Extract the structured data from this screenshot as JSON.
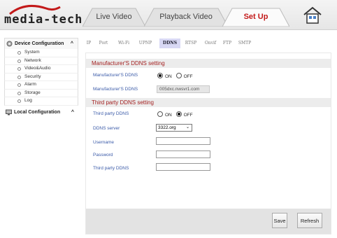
{
  "brand": {
    "name": "media-tech"
  },
  "main_tabs": [
    {
      "label": "Live Video"
    },
    {
      "label": "Playback Video"
    },
    {
      "label": "Set Up",
      "active": true
    }
  ],
  "sidebar": {
    "device_config": {
      "label": "Device Configuration",
      "caret": "^"
    },
    "items": [
      {
        "label": "System"
      },
      {
        "label": "Network"
      },
      {
        "label": "Video&Audio"
      },
      {
        "label": "Security"
      },
      {
        "label": "Alarm"
      },
      {
        "label": "Storage"
      },
      {
        "label": "Log"
      }
    ],
    "local_config": {
      "label": "Local Configuration",
      "caret": "^"
    }
  },
  "subtabs": [
    {
      "label": "IP"
    },
    {
      "label": "Port"
    },
    {
      "label": "Wi-Fi"
    },
    {
      "label": "UPNP"
    },
    {
      "label": "DDNS",
      "active": true
    },
    {
      "label": "RTSP"
    },
    {
      "label": "Onvif"
    },
    {
      "label": "FTP"
    },
    {
      "label": "SMTP"
    }
  ],
  "manufacturer": {
    "title": "Manufacturer'S DDNS setting",
    "ddns_label": "Manufacturer'S DDNS",
    "on_label": "ON",
    "off_label": "OFF",
    "selected": "ON",
    "address_label": "Manufacturer'S DDNS",
    "address_value": "005dxc.nwsvr1.com"
  },
  "third_party": {
    "title": "Third party DDNS setting",
    "ddns_label": "Third party DDNS",
    "on_label": "ON",
    "off_label": "OFF",
    "selected": "OFF",
    "server_label": "DDNS server",
    "server_value": "3322.org",
    "username_label": "Username",
    "username_value": "",
    "password_label": "Password",
    "password_value": "",
    "third_label": "Third party DDNS",
    "third_value": ""
  },
  "buttons": {
    "save": "Save",
    "refresh": "Refresh"
  },
  "colors": {
    "active_tab": "#c31a1a",
    "section_title": "#a32020",
    "field_label": "#3a5aa8",
    "active_subtab": "#d8d8f4"
  }
}
